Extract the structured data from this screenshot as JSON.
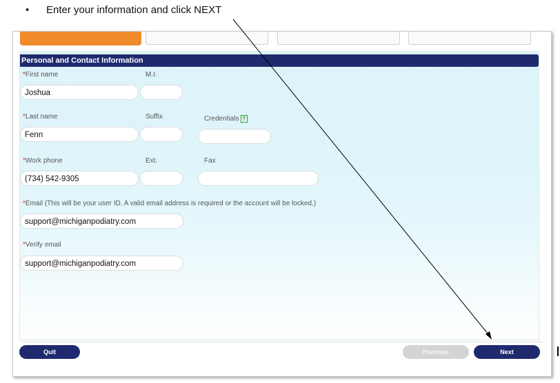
{
  "instruction": {
    "bullet": "•",
    "text": "Enter your information and click NEXT"
  },
  "section": {
    "title": "Personal and Contact Information"
  },
  "labels": {
    "required_marker": "*",
    "first_name": "First name",
    "mi": "M.I.",
    "last_name": "Last name",
    "suffix": "Suffix",
    "credentials": "Credentials",
    "work_phone": "Work phone",
    "ext": "Ext.",
    "fax": "Fax",
    "email": "Email (This will be your user ID. A valid email address is required or the account will be locked.)",
    "verify_email": "Verify email"
  },
  "values": {
    "first_name": "Joshua",
    "mi": "",
    "last_name": "Fenn",
    "suffix": "",
    "credentials": "",
    "work_phone": "(734) 542-9305",
    "ext": "",
    "fax": "",
    "email": "support@michiganpodiatry.com",
    "verify_email": "support@michiganpodiatry.com"
  },
  "help_icon": {
    "name": "help-icon",
    "glyph": "?"
  },
  "buttons": {
    "quit": "Quit",
    "previous": "Previous",
    "next": "Next"
  },
  "colors": {
    "header": "#1f2a6e",
    "accent_tab": "#f08a2b",
    "required": "#e02020",
    "help": "#2c9a3a",
    "background": "#dcf3f9"
  }
}
